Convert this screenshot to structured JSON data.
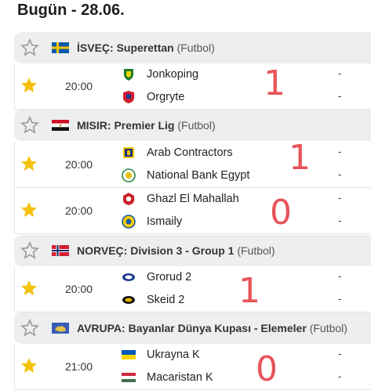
{
  "date_title": "Bugün - 28.06.",
  "leagues": [
    {
      "country": "İSVEÇ:",
      "name": "Superettan",
      "sport": "(Futbol)",
      "flag": "sweden-flag",
      "matches": [
        {
          "time": "20:00",
          "home": "Jonkoping",
          "away": "Orgryte",
          "home_score": "-",
          "away_score": "-",
          "favorite": true,
          "note": "1"
        }
      ]
    },
    {
      "country": "MISIR:",
      "name": "Premier Lig",
      "sport": "(Futbol)",
      "flag": "egypt-flag",
      "matches": [
        {
          "time": "20:00",
          "home": "Arab Contractors",
          "away": "National Bank Egypt",
          "home_score": "-",
          "away_score": "-",
          "favorite": true,
          "note": "1"
        },
        {
          "time": "20:00",
          "home": "Ghazl El Mahallah",
          "away": "Ismaily",
          "home_score": "-",
          "away_score": "-",
          "favorite": true,
          "note": "0"
        }
      ]
    },
    {
      "country": "NORVEÇ:",
      "name": "Division 3 - Group 1",
      "sport": "(Futbol)",
      "flag": "norway-flag",
      "matches": [
        {
          "time": "20:00",
          "home": "Grorud 2",
          "away": "Skeid 2",
          "home_score": "-",
          "away_score": "-",
          "favorite": true,
          "note": "1"
        }
      ]
    },
    {
      "country": "AVRUPA:",
      "name": "Bayanlar Dünya Kupası - Elemeler",
      "sport": "(Futbol)",
      "flag": "europe-flag",
      "matches": [
        {
          "time": "21:00",
          "home": "Ukrayna K",
          "away": "Macaristan K",
          "home_score": "-",
          "away_score": "-",
          "favorite": true,
          "note": "0"
        }
      ]
    }
  ],
  "colors": {
    "header_bg": "#eceef0",
    "star_active": "#f4c20d",
    "star_outline": "#9a9a9a",
    "handnote": "#e8545a"
  }
}
